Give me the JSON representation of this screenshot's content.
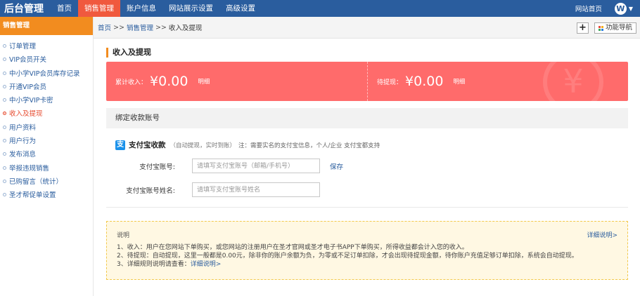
{
  "topnav": {
    "brand": "后台管理",
    "items": [
      "首页",
      "销售管理",
      "账户信息",
      "网站展示设置",
      "高级设置"
    ],
    "site_home": "网站首页",
    "avatar_letter": "W"
  },
  "sidebar": {
    "header": "销售管理",
    "items": [
      "订单管理",
      "VIP会员开关",
      "中小学VIP会员库存记录",
      "开通VIP会员",
      "中小学VIP卡密",
      "收入及提现",
      "用户资料",
      "用户行为",
      "发布消息",
      "举报违规销售",
      "已购留言（统计）",
      "圣才帮促单设置"
    ]
  },
  "breadcrumb": {
    "items": [
      "首页",
      "销售管理",
      "收入及提现"
    ],
    "sep": ">>",
    "plus": "+",
    "func_nav": "功能导航"
  },
  "page": {
    "title": "收入及提现",
    "income_label": "累计收入：",
    "income_amount": "¥0.00",
    "pending_label": "待提现：",
    "pending_amount": "¥0.00",
    "detail_link": "明细",
    "yen_symbol": "¥"
  },
  "bind": {
    "header": "绑定收款账号",
    "alipay_icon": "支",
    "alipay_title": "支付宝收款",
    "alipay_note": "（自动提现，实时到账）",
    "alipay_desc": "注：需要实名的支付宝信息，个人/企业 支付宝都支持",
    "account_label": "支付宝账号:",
    "account_placeholder": "请填写支付宝账号（邮箱/手机号）",
    "save": "保存",
    "name_label": "支付宝账号姓名:",
    "name_placeholder": "请填写支付宝账号姓名"
  },
  "notice": {
    "title": "说明",
    "more": "详细说明>",
    "line1": "1、收入：用户在您网站下单购买，或您网站的注册用户在圣才官网或圣才电子书APP下单购买，所得收益都会计入您的收入。",
    "line2": "2、待提现：自动提现，这里一般都是0.00元，除非你的账户余额为负，为零或不足订单扣除，才会出现待提现金额，待你账户充值足够订单扣除，系统会自动提现。",
    "line3_prefix": "3、详细规则说明请查看：",
    "line3_link": "详细说明>"
  },
  "colors": {
    "topbar": "#2a5d9e",
    "nav_active": "#f0593e",
    "sidebar_header": "#f28c1f",
    "banner": "#ff6b6b",
    "link": "#2a5d9e",
    "alipay": "#1a91ea",
    "notice_bg": "#fff8e3"
  }
}
